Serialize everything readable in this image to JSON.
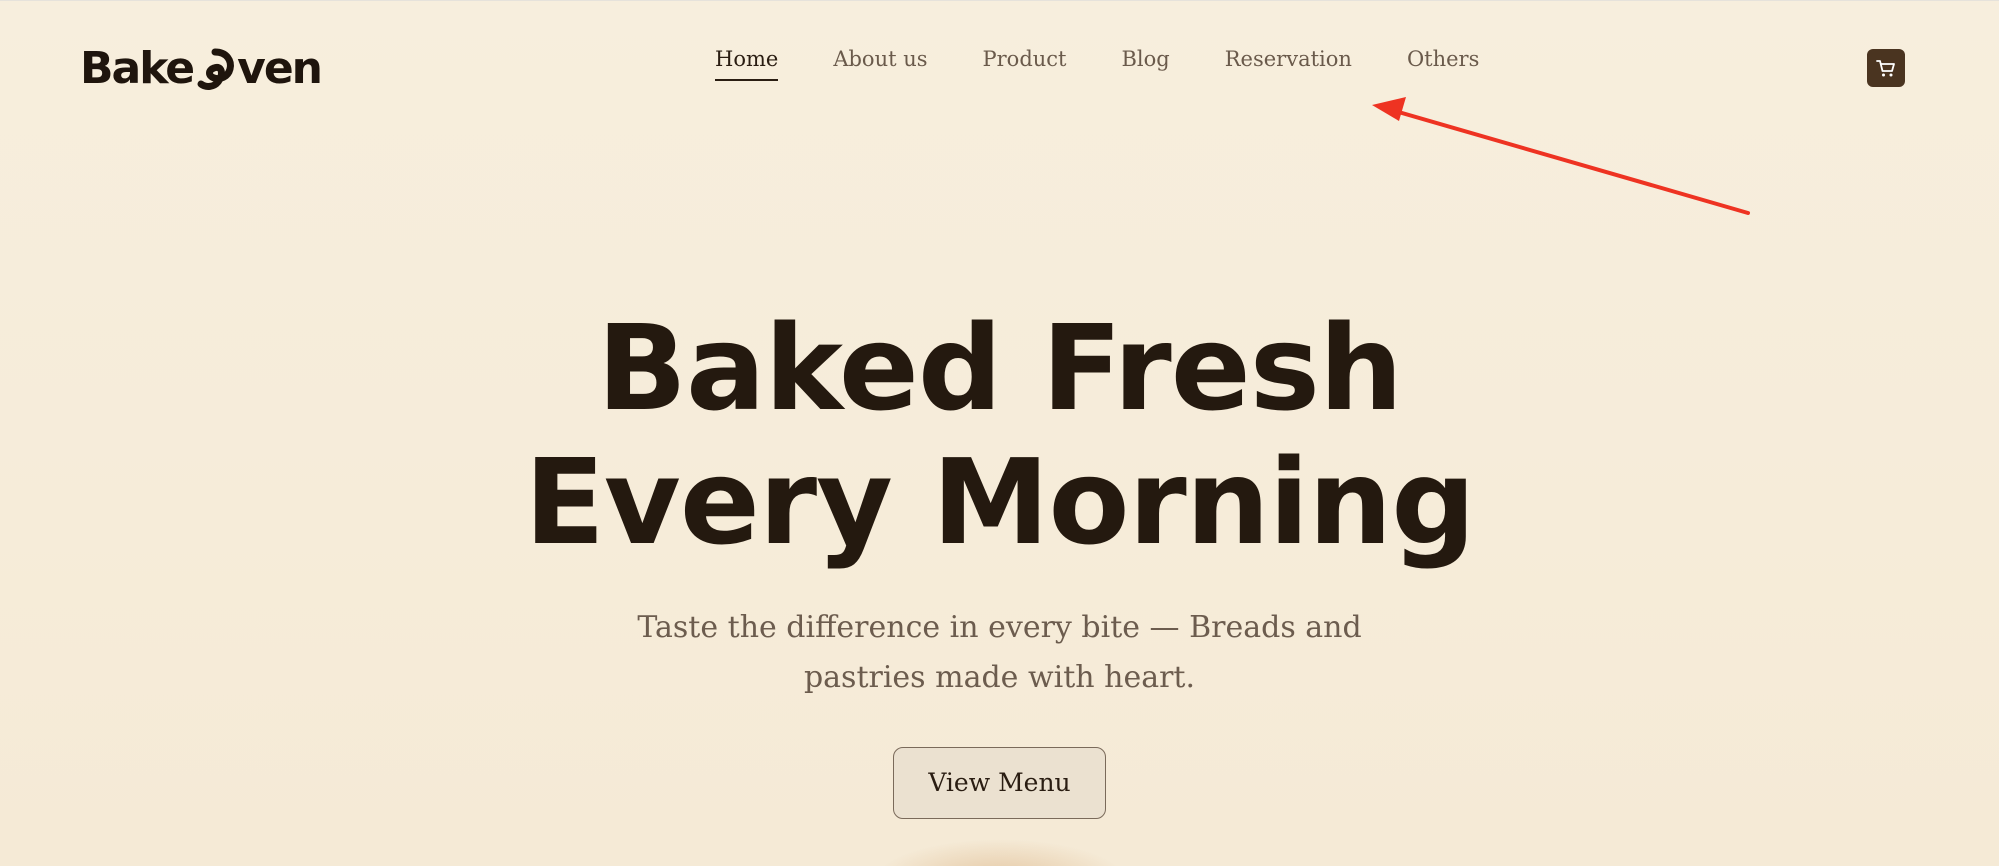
{
  "brand": {
    "logo_text_left": "Bake",
    "logo_text_right": "ven",
    "logo_mark_icon": "oven-swirl-icon"
  },
  "nav": {
    "items": [
      {
        "label": "Home",
        "active": true
      },
      {
        "label": "About us",
        "active": false
      },
      {
        "label": "Product",
        "active": false
      },
      {
        "label": "Blog",
        "active": false
      },
      {
        "label": "Reservation",
        "active": false
      },
      {
        "label": "Others",
        "active": false
      }
    ]
  },
  "cart": {
    "icon": "cart-icon"
  },
  "hero": {
    "title_line1": "Baked Fresh",
    "title_line2": "Every Morning",
    "subtitle_line1": "Taste the difference in every bite — Breads and",
    "subtitle_line2": "pastries made with heart.",
    "cta_label": "View Menu"
  },
  "annotation": {
    "icon": "arrow-annotation-icon",
    "color": "#ee3322"
  },
  "colors": {
    "background": "#f7eddb",
    "text_dark": "#24190f",
    "text_muted": "#6c5c4e",
    "cart_bg": "#4a3420"
  }
}
